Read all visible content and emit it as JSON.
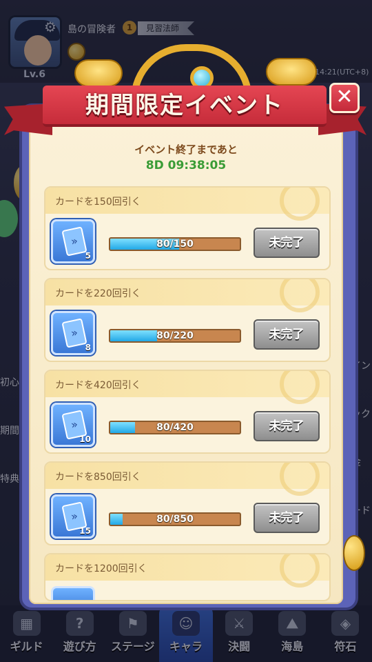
{
  "player": {
    "name": "島の冒険者",
    "rank_number": "1",
    "rank_title": "見習法師",
    "level": "Lv.6",
    "server_time": "14:21(UTC+8)"
  },
  "side_menu": {
    "left": [
      "初心",
      "期間",
      "特典"
    ],
    "right": [
      "イン",
      "ック",
      "金",
      "ード"
    ]
  },
  "bottom_nav": [
    {
      "label": "ギルド",
      "icon": "guild-icon"
    },
    {
      "label": "遊び方",
      "icon": "howto-icon"
    },
    {
      "label": "ステージ",
      "icon": "stage-icon"
    },
    {
      "label": "キャラ",
      "icon": "character-icon",
      "active": true
    },
    {
      "label": "決闘",
      "icon": "duel-icon"
    },
    {
      "label": "海島",
      "icon": "island-icon"
    },
    {
      "label": "符石",
      "icon": "rune-icon"
    }
  ],
  "dialog": {
    "title": "期間限定イベント",
    "close_symbol": "✕",
    "countdown_label": "イベント終了まであと",
    "countdown_value": "8D 09:38:05"
  },
  "tasks": [
    {
      "title": "カードを150回引く",
      "reward_count": "5",
      "progress_text": "80/150",
      "progress": 0.533,
      "status_label": "未完了"
    },
    {
      "title": "カードを220回引く",
      "reward_count": "8",
      "progress_text": "80/220",
      "progress": 0.364,
      "status_label": "未完了"
    },
    {
      "title": "カードを420回引く",
      "reward_count": "10",
      "progress_text": "80/420",
      "progress": 0.19,
      "status_label": "未完了"
    },
    {
      "title": "カードを850回引く",
      "reward_count": "15",
      "progress_text": "80/850",
      "progress": 0.094,
      "status_label": "未完了"
    },
    {
      "title": "カードを1200回引く"
    }
  ],
  "colors": {
    "accent_red": "#c62c3a",
    "progress_blue": "#22a8e6",
    "countdown_green": "#3a9c36"
  }
}
